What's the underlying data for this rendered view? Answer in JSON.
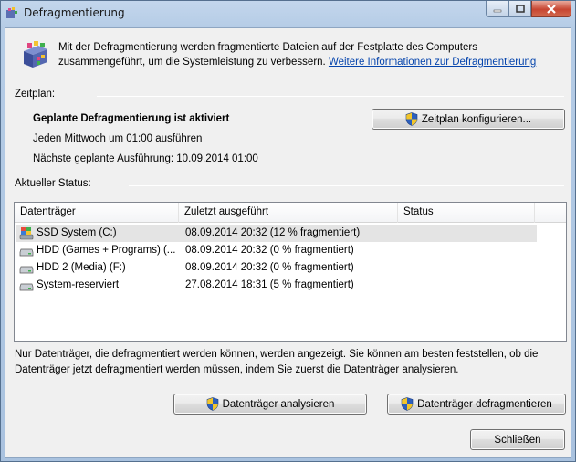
{
  "window": {
    "title": "Defragmentierung",
    "minimize_icon": "minimize-icon",
    "maximize_icon": "maximize-icon",
    "close_icon": "close-icon"
  },
  "intro": {
    "text": "Mit der Defragmentierung werden fragmentierte Dateien auf der Festplatte des Computers zusammengeführt, um die Systemleistung zu verbessern.",
    "link": "Weitere Informationen zur Defragmentierung",
    "icon": "defrag-app-icon"
  },
  "schedule": {
    "label": "Zeitplan:",
    "status": "Geplante Defragmentierung ist aktiviert",
    "when": "Jeden Mittwoch um 01:00 ausführen",
    "next_run": "Nächste geplante Ausführung: 10.09.2014 01:00",
    "configure_button": "Zeitplan konfigurieren..."
  },
  "current_status": {
    "label": "Aktueller Status:",
    "columns": [
      "Datenträger",
      "Zuletzt ausgeführt",
      "Status"
    ],
    "rows": [
      {
        "drive": "SSD System (C:)",
        "last_run": "08.09.2014 20:32 (12 % fragmentiert)",
        "status": "",
        "icon": "system-drive-icon"
      },
      {
        "drive": "HDD  (Games + Programs) (...",
        "last_run": "08.09.2014 20:32 (0 % fragmentiert)",
        "status": "",
        "icon": "hard-drive-icon"
      },
      {
        "drive": "HDD 2 (Media) (F:)",
        "last_run": "08.09.2014 20:32 (0 % fragmentiert)",
        "status": "",
        "icon": "hard-drive-icon"
      },
      {
        "drive": "System-reserviert",
        "last_run": "27.08.2014 18:31 (5 % fragmentiert)",
        "status": "",
        "icon": "hard-drive-icon"
      }
    ]
  },
  "footer": {
    "note": "Nur Datenträger, die defragmentiert werden können, werden angezeigt. Sie können am besten feststellen, ob die Datenträger jetzt defragmentiert werden müssen, indem Sie zuerst die Datenträger analysieren.",
    "analyze_button": "Datenträger analysieren",
    "defrag_button": "Datenträger defragmentieren",
    "close_button": "Schließen"
  }
}
